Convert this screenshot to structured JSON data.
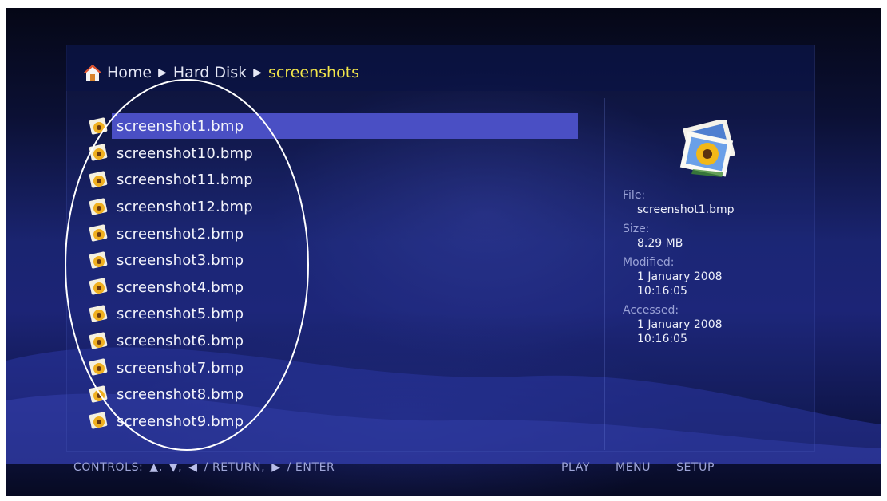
{
  "breadcrumb": {
    "home": "Home",
    "middle": "Hard Disk",
    "current": "screenshots",
    "separator": "▶"
  },
  "files": [
    {
      "name": "screenshot1.bmp",
      "selected": true
    },
    {
      "name": "screenshot10.bmp"
    },
    {
      "name": "screenshot11.bmp"
    },
    {
      "name": "screenshot12.bmp"
    },
    {
      "name": "screenshot2.bmp"
    },
    {
      "name": "screenshot3.bmp"
    },
    {
      "name": "screenshot4.bmp"
    },
    {
      "name": "screenshot5.bmp"
    },
    {
      "name": "screenshot6.bmp"
    },
    {
      "name": "screenshot7.bmp"
    },
    {
      "name": "screenshot8.bmp"
    },
    {
      "name": "screenshot9.bmp"
    }
  ],
  "info": {
    "file_label": "File:",
    "file_value": "screenshot1.bmp",
    "size_label": "Size:",
    "size_value": "8.29 MB",
    "modified_label": "Modified:",
    "modified_date": "1 January 2008",
    "modified_time": "10:16:05",
    "accessed_label": "Accessed:",
    "accessed_date": "1 January 2008",
    "accessed_time": "10:16:05"
  },
  "controls": {
    "label": "CONTROLS:",
    "up": "▲,",
    "down": "▼,",
    "left": "◀",
    "return": "/ RETURN,",
    "right": "▶",
    "enter": "/ ENTER"
  },
  "nav": {
    "play": "PLAY",
    "menu": "MENU",
    "setup": "SETUP"
  },
  "icons": {
    "home": "home-icon",
    "file": "image-file-icon",
    "thumbnail": "photo-thumbnail-icon"
  },
  "colors": {
    "selection": "#4a4fc4",
    "breadcrumb_current": "#f2e64a",
    "background": "#1a2470"
  }
}
